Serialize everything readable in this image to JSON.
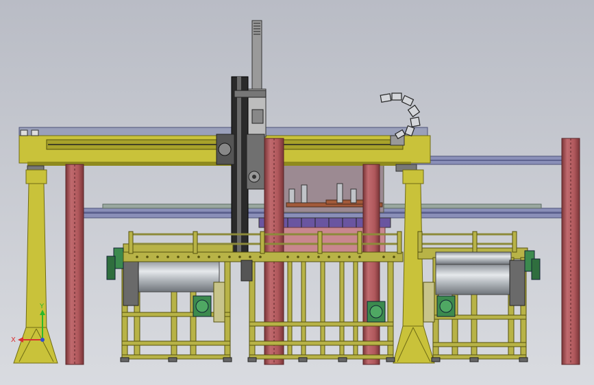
{
  "viewport": {
    "background_top": "#b9bcc5",
    "background_bottom": "#d9dbe0"
  },
  "colors": {
    "gantry_yellow": "#c9c23a",
    "gantry_yellow_dark": "#8f8a1e",
    "column_red": "#b0585c",
    "column_red_dark": "#7a3538",
    "rail_blue": "#8a8fb8",
    "rail_blue_dark": "#4c5178",
    "steel_black": "#2a2a2a",
    "steel_gray": "#9a9a9a",
    "roll_silver": "#cfd3d8",
    "motor_green": "#3c8a4e",
    "frame_olive": "#b8b347",
    "pink_panel": "#c9878e",
    "axis_x": "#d93030",
    "axis_y": "#2bb82b",
    "axis_z": "#3050d0"
  },
  "triad": {
    "x_label": "X",
    "y_label": "Y"
  }
}
